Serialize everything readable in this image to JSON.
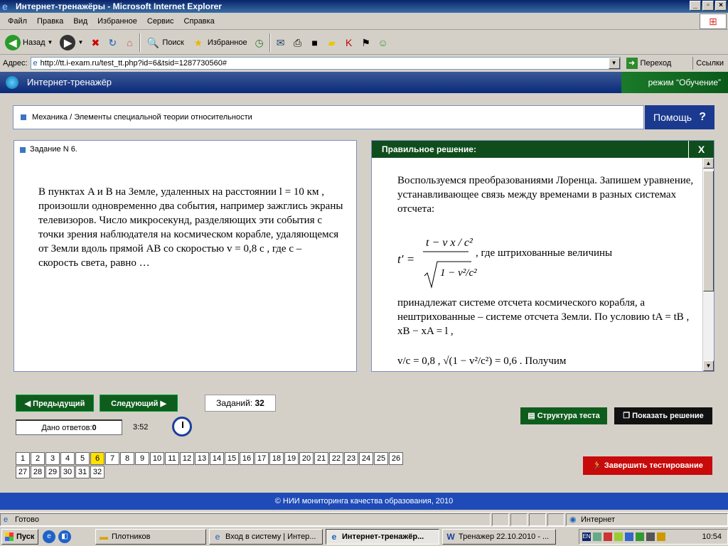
{
  "window": {
    "title": "Интернет-тренажёры - Microsoft Internet Explorer"
  },
  "menu": [
    "Файл",
    "Правка",
    "Вид",
    "Избранное",
    "Сервис",
    "Справка"
  ],
  "toolbar": {
    "back": "Назад",
    "search": "Поиск",
    "favorites": "Избранное"
  },
  "address": {
    "label": "Адрес:",
    "url": "http://tt.i-exam.ru/test_tt.php?id=6&tsid=1287730560#",
    "go": "Переход",
    "links": "Ссылки"
  },
  "app": {
    "title": "Интернет-тренажёр",
    "mode": "режим “Обучение”"
  },
  "breadcrumb": "Механика / Элементы специальной теории относительности",
  "help": "Помощь",
  "task": {
    "number": "Задание N 6.",
    "text": "В пунктах  A и B на Земле, удаленных на расстоянии  l = 10 км , произошли одновременно два события, например зажглись экраны телевизоров. Число микросекунд, разделяющих эти события с точки зрения наблюдателя на космическом  корабле, удаляющемся от Земли вдоль прямой  AB со скоростью  v = 0,8 c , где c – скорость света, равно …"
  },
  "solution": {
    "header": "Правильное решение:",
    "close": "X",
    "intro": "Воспользуемся преобразованиями Лоренца. Запишем уравнение, устанавливающее связь между временами в разных системах отсчета:",
    "formula_label": "t′ = (t − v x / c²) / √(1 − v²/c²)",
    "after_formula": ", где штрихованные величины",
    "rest": "принадлежат системе отсчета космического корабля, а нештрихованные – системе отсчета Земли. По условию  tA = tB ,  xB − xA = l ,",
    "cond": "v/c = 0,8 ,  √(1 − v²/c²) = 0,6 . Получим"
  },
  "nav": {
    "prev": "Предыдущий",
    "next": "Следующий",
    "tasks_label": "Заданий:",
    "tasks_count": "32",
    "answered_label": "Дано ответов:",
    "answered_count": "0",
    "timer": "3:52",
    "structure": "Структура теста",
    "show_solution": "Показать решение",
    "finish": "Завершить тестирование"
  },
  "pages": [
    "1",
    "2",
    "3",
    "4",
    "5",
    "6",
    "7",
    "8",
    "9",
    "10",
    "11",
    "12",
    "13",
    "14",
    "15",
    "16",
    "17",
    "18",
    "19",
    "20",
    "21",
    "22",
    "23",
    "24",
    "25",
    "26",
    "27",
    "28",
    "29",
    "30",
    "31",
    "32"
  ],
  "current_page": "6",
  "footer": "© НИИ мониторинга качества образования, 2010",
  "status": {
    "ready": "Готово",
    "zone": "Интернет"
  },
  "taskbar": {
    "start": "Пуск",
    "items": [
      "Плотников",
      "Вход в систему | Интер...",
      "Интернет-тренажёр...",
      "Тренажер 22.10.2010 - ..."
    ],
    "active_index": 2,
    "clock": "10:54",
    "lang": "EN"
  }
}
